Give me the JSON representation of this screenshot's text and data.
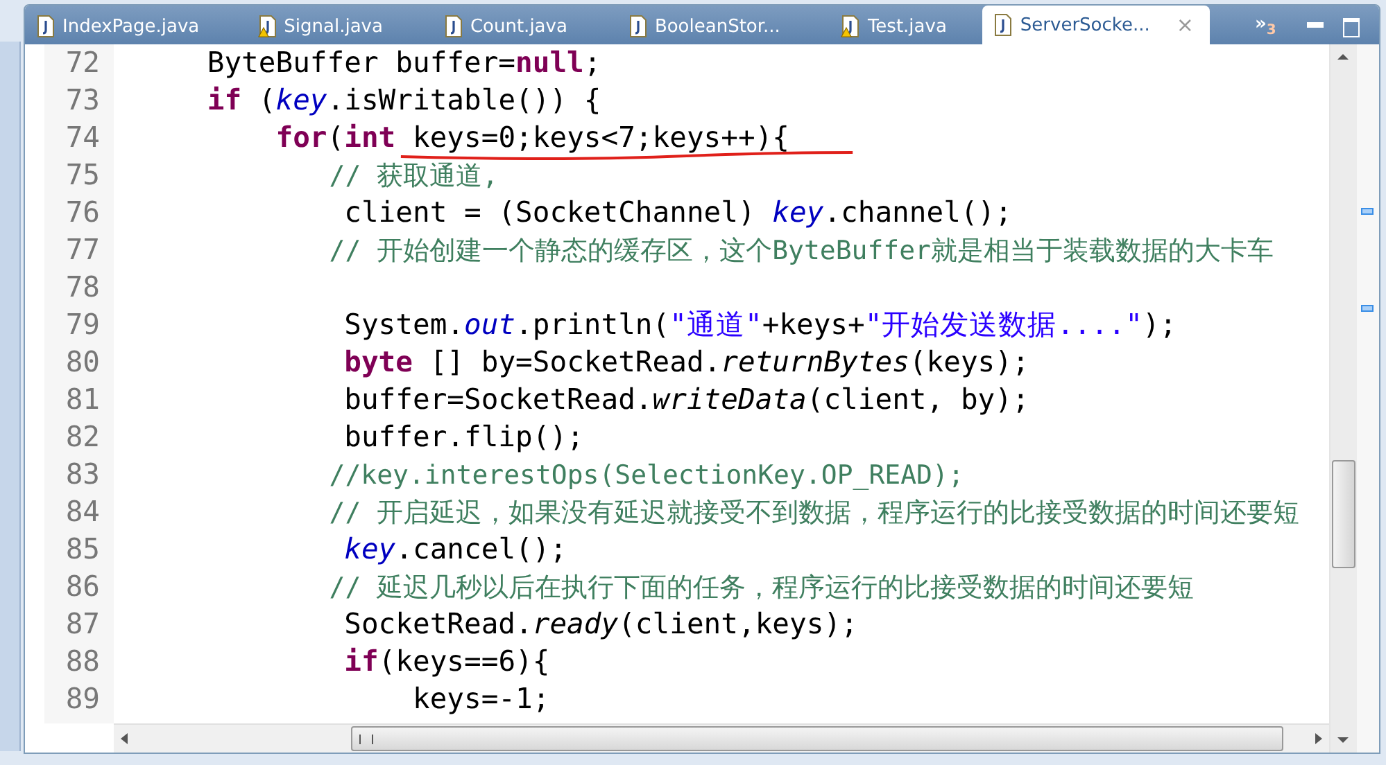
{
  "tabs": [
    {
      "label": "IndexPage.java",
      "warning": false,
      "selected": false
    },
    {
      "label": "Signal.java",
      "warning": true,
      "selected": false
    },
    {
      "label": "Count.java",
      "warning": false,
      "selected": false
    },
    {
      "label": "BooleanStor...",
      "warning": false,
      "selected": false
    },
    {
      "label": "Test.java",
      "warning": true,
      "selected": false
    },
    {
      "label": "ServerSocke...",
      "warning": false,
      "selected": true,
      "close": "×"
    }
  ],
  "overflow": {
    "symbol": "»",
    "count": "3"
  },
  "editor": {
    "lines": [
      {
        "number": "72",
        "tokens": [
          {
            "text": "    ByteBuffer buffer=",
            "kind": "plain"
          },
          {
            "text": "null",
            "kind": "keyword"
          },
          {
            "text": ";",
            "kind": "plain"
          }
        ]
      },
      {
        "number": "73",
        "tokens": [
          {
            "text": "    if",
            "kind": "keyword"
          },
          {
            "text": " (",
            "kind": "plain"
          },
          {
            "text": "key",
            "kind": "field"
          },
          {
            "text": ".isWritable()) {",
            "kind": "plain"
          }
        ]
      },
      {
        "number": "74",
        "tokens": [
          {
            "text": "        for",
            "kind": "keyword"
          },
          {
            "text": "(",
            "kind": "plain"
          },
          {
            "text": "int ",
            "kind": "keyword"
          },
          {
            "text": "keys=0;keys<7;keys++){",
            "kind": "plain",
            "underlined": true
          }
        ]
      },
      {
        "number": "75",
        "tokens": [
          {
            "text": "            // 获取通道,",
            "kind": "comment"
          }
        ]
      },
      {
        "number": "76",
        "tokens": [
          {
            "text": "            client = (SocketChannel) ",
            "kind": "plain"
          },
          {
            "text": "key",
            "kind": "field"
          },
          {
            "text": ".channel();",
            "kind": "plain"
          }
        ]
      },
      {
        "number": "77",
        "tokens": [
          {
            "text": "            // 开始创建一个静态的缓存区，这个ByteBuffer就是相当于装载数据的大卡车",
            "kind": "comment"
          }
        ]
      },
      {
        "number": "78"
      },
      {
        "number": "79",
        "tokens": [
          {
            "text": "            System.",
            "kind": "plain"
          },
          {
            "text": "out",
            "kind": "field"
          },
          {
            "text": ".println(",
            "kind": "plain"
          },
          {
            "text": "\"通道\"",
            "kind": "string"
          },
          {
            "text": "+keys+",
            "kind": "plain"
          },
          {
            "text": "\"开始发送数据....\"",
            "kind": "string"
          },
          {
            "text": ");",
            "kind": "plain"
          }
        ]
      },
      {
        "number": "80",
        "tokens": [
          {
            "text": "            byte",
            "kind": "keyword"
          },
          {
            "text": " [] by=SocketRead.",
            "kind": "plain"
          },
          {
            "text": "returnBytes",
            "kind": "static"
          },
          {
            "text": "(keys);",
            "kind": "plain"
          }
        ]
      },
      {
        "number": "81",
        "tokens": [
          {
            "text": "            buffer=SocketRead.",
            "kind": "plain"
          },
          {
            "text": "writeData",
            "kind": "static"
          },
          {
            "text": "(client, by);",
            "kind": "plain"
          }
        ]
      },
      {
        "number": "82",
        "tokens": [
          {
            "text": "            buffer.flip();",
            "kind": "plain"
          }
        ]
      },
      {
        "number": "83",
        "tokens": [
          {
            "text": "            //key.interestOps(SelectionKey.OP_READ);",
            "kind": "comment"
          }
        ]
      },
      {
        "number": "84",
        "tokens": [
          {
            "text": "            // 开启延迟，如果没有延迟就接受不到数据，程序运行的比接受数据的时间还要短",
            "kind": "comment"
          }
        ]
      },
      {
        "number": "85",
        "tokens": [
          {
            "text": "            key",
            "kind": "field"
          },
          {
            "text": ".cancel();",
            "kind": "plain"
          }
        ]
      },
      {
        "number": "86",
        "tokens": [
          {
            "text": "            // 延迟几秒以后在执行下面的任务，程序运行的比接受数据的时间还要短",
            "kind": "comment"
          }
        ]
      },
      {
        "number": "87",
        "tokens": [
          {
            "text": "            SocketRead.",
            "kind": "plain"
          },
          {
            "text": "ready",
            "kind": "static"
          },
          {
            "text": "(client,keys);",
            "kind": "plain"
          }
        ]
      },
      {
        "number": "88",
        "tokens": [
          {
            "text": "            if",
            "kind": "keyword"
          },
          {
            "text": "(keys==6){",
            "kind": "plain"
          }
        ]
      },
      {
        "number": "89",
        "tokens": [
          {
            "text": "                keys=-1;",
            "kind": "plain"
          }
        ]
      }
    ]
  }
}
